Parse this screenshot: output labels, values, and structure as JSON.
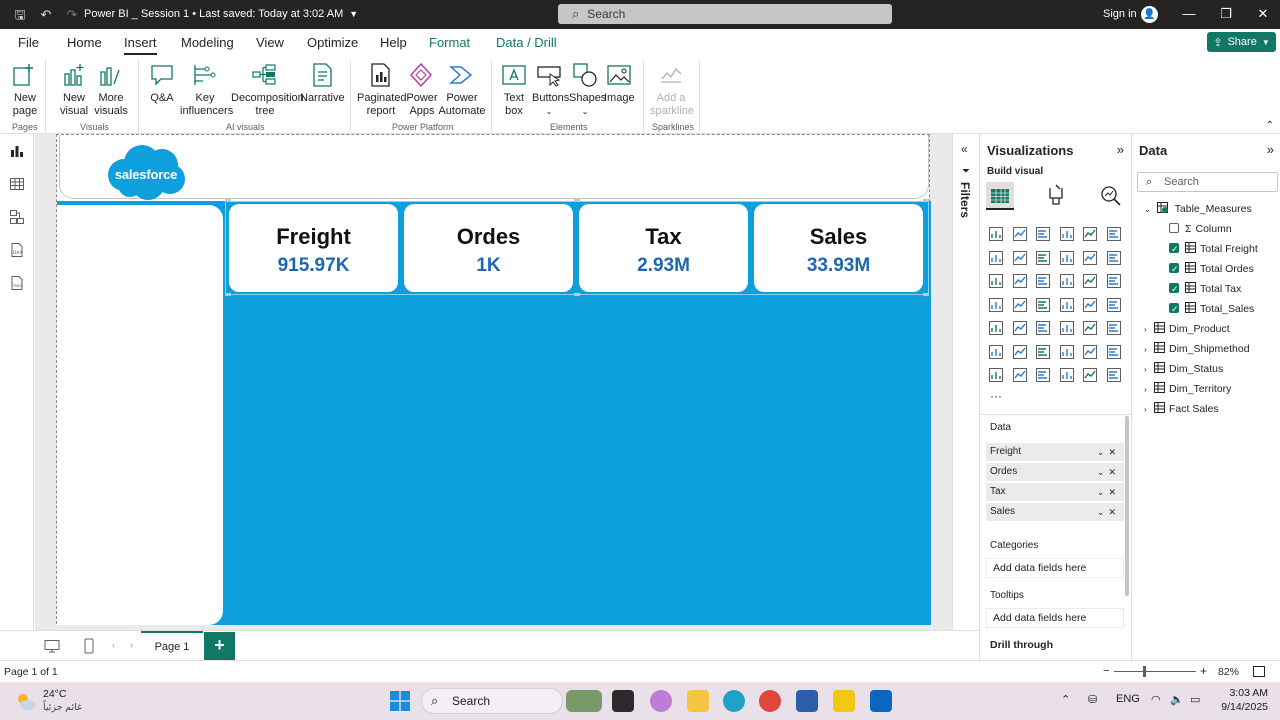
{
  "window": {
    "title": "Power BI _ Session 1 • Last saved: Today at 3:02 AM",
    "search_placeholder": "Search",
    "sign_in": "Sign in"
  },
  "menu": {
    "tabs": [
      {
        "label": "File"
      },
      {
        "label": "Home"
      },
      {
        "label": "Insert"
      },
      {
        "label": "Modeling"
      },
      {
        "label": "View"
      },
      {
        "label": "Optimize"
      },
      {
        "label": "Help"
      },
      {
        "label": "Format"
      },
      {
        "label": "Data / Drill"
      }
    ],
    "active": "Insert",
    "share_label": "Share"
  },
  "ribbon": {
    "buttons": {
      "new_page": "New page",
      "new_visual": "New visual",
      "more_visuals": "More visuals",
      "qa": "Q&A",
      "key_influencers": "Key influencers",
      "decomposition_tree": "Decomposition tree",
      "narrative": "Narrative",
      "paginated_report": "Paginated report",
      "power_apps": "Power Apps",
      "power_automate": "Power Automate",
      "text_box": "Text box",
      "buttons": "Buttons",
      "shapes": "Shapes",
      "image": "Image",
      "add_sparkline": "Add a sparkline"
    },
    "groups": {
      "pages": "Pages",
      "visuals": "Visuals",
      "ai_visuals": "AI visuals",
      "power_platform": "Power Platform",
      "elements": "Elements",
      "sparklines": "Sparklines"
    }
  },
  "canvas": {
    "logo_text": "salesforce",
    "kpis": [
      {
        "label": "Freight",
        "value": "915.97K"
      },
      {
        "label": "Ordes",
        "value": "1K"
      },
      {
        "label": "Tax",
        "value": "2.93M"
      },
      {
        "label": "Sales",
        "value": "33.93M"
      }
    ],
    "colors": {
      "background_blue": "#0ea0dc",
      "kpi_value": "#1f66b1"
    }
  },
  "filters": {
    "label": "Filters"
  },
  "visualizations": {
    "title": "Visualizations",
    "build_visual": "Build visual",
    "wells": {
      "data_header": "Data",
      "data_fields": [
        "Freight",
        "Ordes",
        "Tax",
        "Sales"
      ],
      "categories_header": "Categories",
      "categories_placeholder": "Add data fields here",
      "tooltips_header": "Tooltips",
      "tooltips_placeholder": "Add data fields here",
      "drill_through": "Drill through"
    }
  },
  "data_pane": {
    "title": "Data",
    "search_placeholder": "Search",
    "tree": {
      "table_measures": "Table_Measures",
      "children": [
        {
          "label": "Column",
          "checked": false
        },
        {
          "label": "Total Freight",
          "checked": true
        },
        {
          "label": "Total Ordes",
          "checked": true
        },
        {
          "label": "Total Tax",
          "checked": true
        },
        {
          "label": "Total_Sales",
          "checked": true
        }
      ],
      "tables": [
        "Dim_Product",
        "Dim_Shipmethod",
        "Dim_Status",
        "Dim_Territory",
        "Fact Sales"
      ]
    }
  },
  "pages": {
    "tab_label": "Page 1"
  },
  "status": {
    "page_info": "Page 1 of 1",
    "zoom": "82%"
  },
  "taskbar": {
    "temperature": "24°C",
    "weather": "غائم جزئياً",
    "search": "Search",
    "language": "ENG",
    "time": "3:03 AM",
    "date": "9/14/2025"
  }
}
